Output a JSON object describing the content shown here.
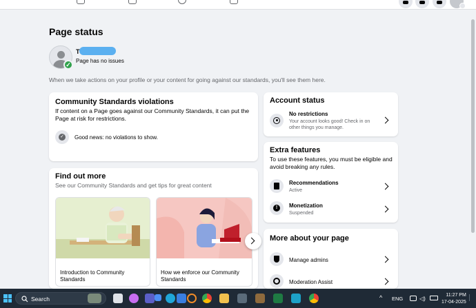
{
  "header": {
    "title": "Page status",
    "page_name": "T",
    "page_status": "Page has no issues",
    "intro": "When we take actions on your profile or your content for going against our standards, you'll see them here."
  },
  "violations": {
    "title": "Community Standards violations",
    "description": "If content on a Page goes against our Community Standards, it can put the Page at risk for restrictions.",
    "good_news": "Good news: no violations to show."
  },
  "find_out": {
    "title": "Find out more",
    "subtitle": "See our Community Standards and get tips for great content",
    "cards": [
      {
        "label": "Introduction to Community Standards"
      },
      {
        "label": "How we enforce our Community Standards"
      }
    ]
  },
  "account_status": {
    "title": "Account status",
    "item_title": "No restrictions",
    "item_sub": "Your account looks good! Check in on other things you manage."
  },
  "extra_features": {
    "title": "Extra features",
    "description": "To use these features, you must be eligible and avoid breaking any rules.",
    "items": [
      {
        "title": "Recommendations",
        "status": "Active",
        "icon": "recommendations-icon"
      },
      {
        "title": "Monetization",
        "status": "Suspended",
        "icon": "monetization-icon"
      }
    ]
  },
  "more_about": {
    "title": "More about your page",
    "items": [
      {
        "title": "Manage admins",
        "icon": "shield-icon"
      },
      {
        "title": "Moderation Assist",
        "icon": "gear-icon"
      }
    ]
  },
  "taskbar": {
    "search_label": "Search",
    "language": "ENG",
    "time": "11:27 PM",
    "date": "17-04-2025"
  },
  "colors": {
    "background": "#f0f2f5",
    "success": "#31a24c",
    "taskbar": "#1f2a36"
  }
}
